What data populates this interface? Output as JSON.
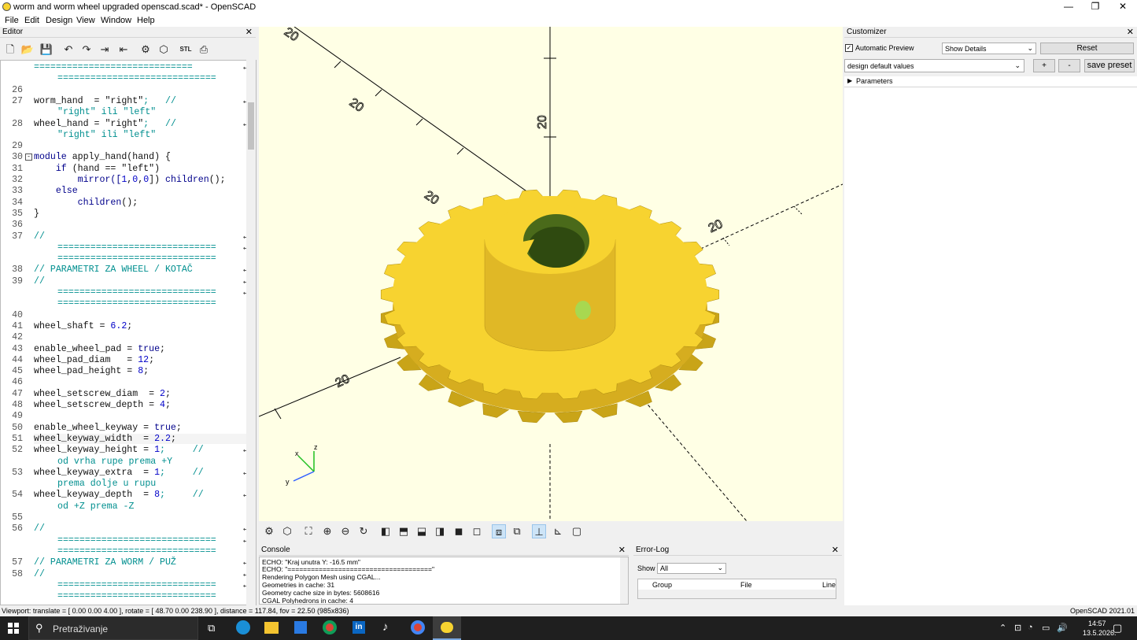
{
  "window": {
    "title": "worm and worm wheel upgraded openscad.scad* - OpenSCAD",
    "min": "—",
    "max": "❐",
    "close": "✕"
  },
  "menu": [
    "File",
    "Edit",
    "Design",
    "View",
    "Window",
    "Help"
  ],
  "editor": {
    "title": "Editor",
    "close": "✕"
  },
  "code_lines": [
    {
      "n": "",
      "segs": [
        [
          "=============================",
          "eq"
        ]
      ],
      "wrap": true
    },
    {
      "n": "",
      "segs": [
        [
          "=============================",
          "eq"
        ]
      ],
      "indent": true
    },
    {
      "n": "26",
      "segs": []
    },
    {
      "n": "27",
      "segs": [
        [
          "worm_hand  = ",
          ""
        ],
        [
          "\"right\"",
          "str"
        ],
        [
          ";   //",
          "cmt"
        ]
      ],
      "wrap": true
    },
    {
      "n": "",
      "segs": [
        [
          "\"right\" ili \"left\"",
          "cmt"
        ]
      ],
      "indent": true
    },
    {
      "n": "28",
      "segs": [
        [
          "wheel_hand = ",
          ""
        ],
        [
          "\"right\"",
          "str"
        ],
        [
          ";   //",
          "cmt"
        ]
      ],
      "wrap": true
    },
    {
      "n": "",
      "segs": [
        [
          "\"right\" ili \"left\"",
          "cmt"
        ]
      ],
      "indent": true
    },
    {
      "n": "29",
      "segs": []
    },
    {
      "n": "30",
      "segs": [
        [
          "module ",
          "kw"
        ],
        [
          "apply_hand(hand) {",
          ""
        ]
      ],
      "fold": true
    },
    {
      "n": "31",
      "segs": [
        [
          "    if ",
          "kw"
        ],
        [
          "(hand == ",
          ""
        ],
        [
          "\"left\"",
          "str"
        ],
        [
          ")",
          ""
        ]
      ]
    },
    {
      "n": "32",
      "segs": [
        [
          "        mirror([",
          "kw"
        ],
        [
          "1",
          "num"
        ],
        [
          ",",
          ""
        ],
        [
          "0",
          "num"
        ],
        [
          ",",
          ""
        ],
        [
          "0",
          "num"
        ],
        [
          "]) ",
          ""
        ],
        [
          "children",
          "kw"
        ],
        [
          "();",
          ""
        ]
      ]
    },
    {
      "n": "33",
      "segs": [
        [
          "    else",
          "kw"
        ]
      ]
    },
    {
      "n": "34",
      "segs": [
        [
          "        children",
          "kw"
        ],
        [
          "();",
          ""
        ]
      ]
    },
    {
      "n": "35",
      "segs": [
        [
          "}",
          ""
        ]
      ]
    },
    {
      "n": "36",
      "segs": []
    },
    {
      "n": "37",
      "segs": [
        [
          "//",
          "cmt"
        ]
      ],
      "wrap": true
    },
    {
      "n": "",
      "segs": [
        [
          "=============================",
          "eq"
        ]
      ],
      "indent": true,
      "wrap": true
    },
    {
      "n": "",
      "segs": [
        [
          "=============================",
          "eq"
        ]
      ],
      "indent": true
    },
    {
      "n": "38",
      "segs": [
        [
          "// PARAMETRI ZA WHEEL / KOTAČ",
          "cmt"
        ]
      ],
      "wrap": true
    },
    {
      "n": "39",
      "segs": [
        [
          "//",
          "cmt"
        ]
      ],
      "wrap": true
    },
    {
      "n": "",
      "segs": [
        [
          "=============================",
          "eq"
        ]
      ],
      "indent": true,
      "wrap": true
    },
    {
      "n": "",
      "segs": [
        [
          "=============================",
          "eq"
        ]
      ],
      "indent": true
    },
    {
      "n": "40",
      "segs": []
    },
    {
      "n": "41",
      "segs": [
        [
          "wheel_shaft = ",
          ""
        ],
        [
          "6.2",
          "num"
        ],
        [
          ";",
          ""
        ]
      ]
    },
    {
      "n": "42",
      "segs": []
    },
    {
      "n": "43",
      "segs": [
        [
          "enable_wheel_pad = ",
          ""
        ],
        [
          "true",
          "kw"
        ],
        [
          ";",
          ""
        ]
      ]
    },
    {
      "n": "44",
      "segs": [
        [
          "wheel_pad_diam   = ",
          ""
        ],
        [
          "12",
          "num"
        ],
        [
          ";",
          ""
        ]
      ]
    },
    {
      "n": "45",
      "segs": [
        [
          "wheel_pad_height = ",
          ""
        ],
        [
          "8",
          "num"
        ],
        [
          ";",
          ""
        ]
      ]
    },
    {
      "n": "46",
      "segs": []
    },
    {
      "n": "47",
      "segs": [
        [
          "wheel_setscrew_diam  = ",
          ""
        ],
        [
          "2",
          "num"
        ],
        [
          ";",
          ""
        ]
      ]
    },
    {
      "n": "48",
      "segs": [
        [
          "wheel_setscrew_depth = ",
          ""
        ],
        [
          "4",
          "num"
        ],
        [
          ";",
          ""
        ]
      ]
    },
    {
      "n": "49",
      "segs": []
    },
    {
      "n": "50",
      "segs": [
        [
          "enable_wheel_keyway = ",
          ""
        ],
        [
          "true",
          "kw"
        ],
        [
          ";",
          ""
        ]
      ]
    },
    {
      "n": "51",
      "segs": [
        [
          "wheel_keyway_width  = ",
          ""
        ],
        [
          "2.2",
          "num"
        ],
        [
          ";",
          ""
        ]
      ],
      "cursor": true
    },
    {
      "n": "52",
      "segs": [
        [
          "wheel_keyway_height = ",
          ""
        ],
        [
          "1",
          "num"
        ],
        [
          ";     //",
          "cmt"
        ]
      ],
      "wrap": true
    },
    {
      "n": "",
      "segs": [
        [
          "od vrha rupe prema +Y",
          "cmt"
        ]
      ],
      "indent": true
    },
    {
      "n": "53",
      "segs": [
        [
          "wheel_keyway_extra  = ",
          ""
        ],
        [
          "1",
          "num"
        ],
        [
          ";     //",
          "cmt"
        ]
      ],
      "wrap": true
    },
    {
      "n": "",
      "segs": [
        [
          "prema dolje u rupu",
          "cmt"
        ]
      ],
      "indent": true
    },
    {
      "n": "54",
      "segs": [
        [
          "wheel_keyway_depth  = ",
          ""
        ],
        [
          "8",
          "num"
        ],
        [
          ";     //",
          "cmt"
        ]
      ],
      "wrap": true
    },
    {
      "n": "",
      "segs": [
        [
          "od +Z prema -Z",
          "cmt"
        ]
      ],
      "indent": true
    },
    {
      "n": "55",
      "segs": []
    },
    {
      "n": "56",
      "segs": [
        [
          "//",
          "cmt"
        ]
      ],
      "wrap": true
    },
    {
      "n": "",
      "segs": [
        [
          "=============================",
          "eq"
        ]
      ],
      "indent": true,
      "wrap": true
    },
    {
      "n": "",
      "segs": [
        [
          "=============================",
          "eq"
        ]
      ],
      "indent": true
    },
    {
      "n": "57",
      "segs": [
        [
          "// PARAMETRI ZA WORM / PUŽ",
          "cmt"
        ]
      ],
      "wrap": true
    },
    {
      "n": "58",
      "segs": [
        [
          "//",
          "cmt"
        ]
      ],
      "wrap": true
    },
    {
      "n": "",
      "segs": [
        [
          "=============================",
          "eq"
        ]
      ],
      "indent": true,
      "wrap": true
    },
    {
      "n": "",
      "segs": [
        [
          "=============================",
          "eq"
        ]
      ],
      "indent": true
    }
  ],
  "viewport": {
    "axis_labels": [
      "20",
      "20",
      "20",
      "20",
      "20",
      "20"
    ],
    "gizmo": {
      "x": "x",
      "y": "y",
      "z": "z"
    }
  },
  "console": {
    "title": "Console",
    "close": "✕",
    "lines": [
      "ECHO: \"Kraj unutra Y:      -16.5 mm\"",
      "ECHO: \"=====================================\"",
      "Rendering Polygon Mesh using CGAL...",
      "Geometries in cache: 31",
      "Geometry cache size in bytes: 5608616",
      "CGAL Polyhedrons in cache: 4"
    ]
  },
  "errorlog": {
    "title": "Error-Log",
    "close": "✕",
    "show_label": "Show",
    "show_value": "All",
    "cols": [
      "Group",
      "File",
      "Line"
    ]
  },
  "customizer": {
    "title": "Customizer",
    "close": "✕",
    "auto_preview": "Automatic Preview",
    "details": "Show Details",
    "reset": "Reset",
    "preset": "design default values",
    "plus": "+",
    "minus": "-",
    "save": "save preset",
    "params": "Parameters"
  },
  "status": {
    "left": "Viewport: translate = [ 0.00 0.00 4.00 ], rotate = [ 48.70 0.00 238.90 ], distance = 117.84, fov = 22.50 (985x836)",
    "right": "OpenSCAD 2021.01"
  },
  "taskbar": {
    "search": "Pretraživanje",
    "time": "14:57",
    "date": "13.5.2026."
  },
  "colors": {
    "gear": "#f7d330",
    "gear_dark": "#c9a418",
    "viewport_bg": "#ffffe5",
    "hole": "#4a6a1a"
  }
}
